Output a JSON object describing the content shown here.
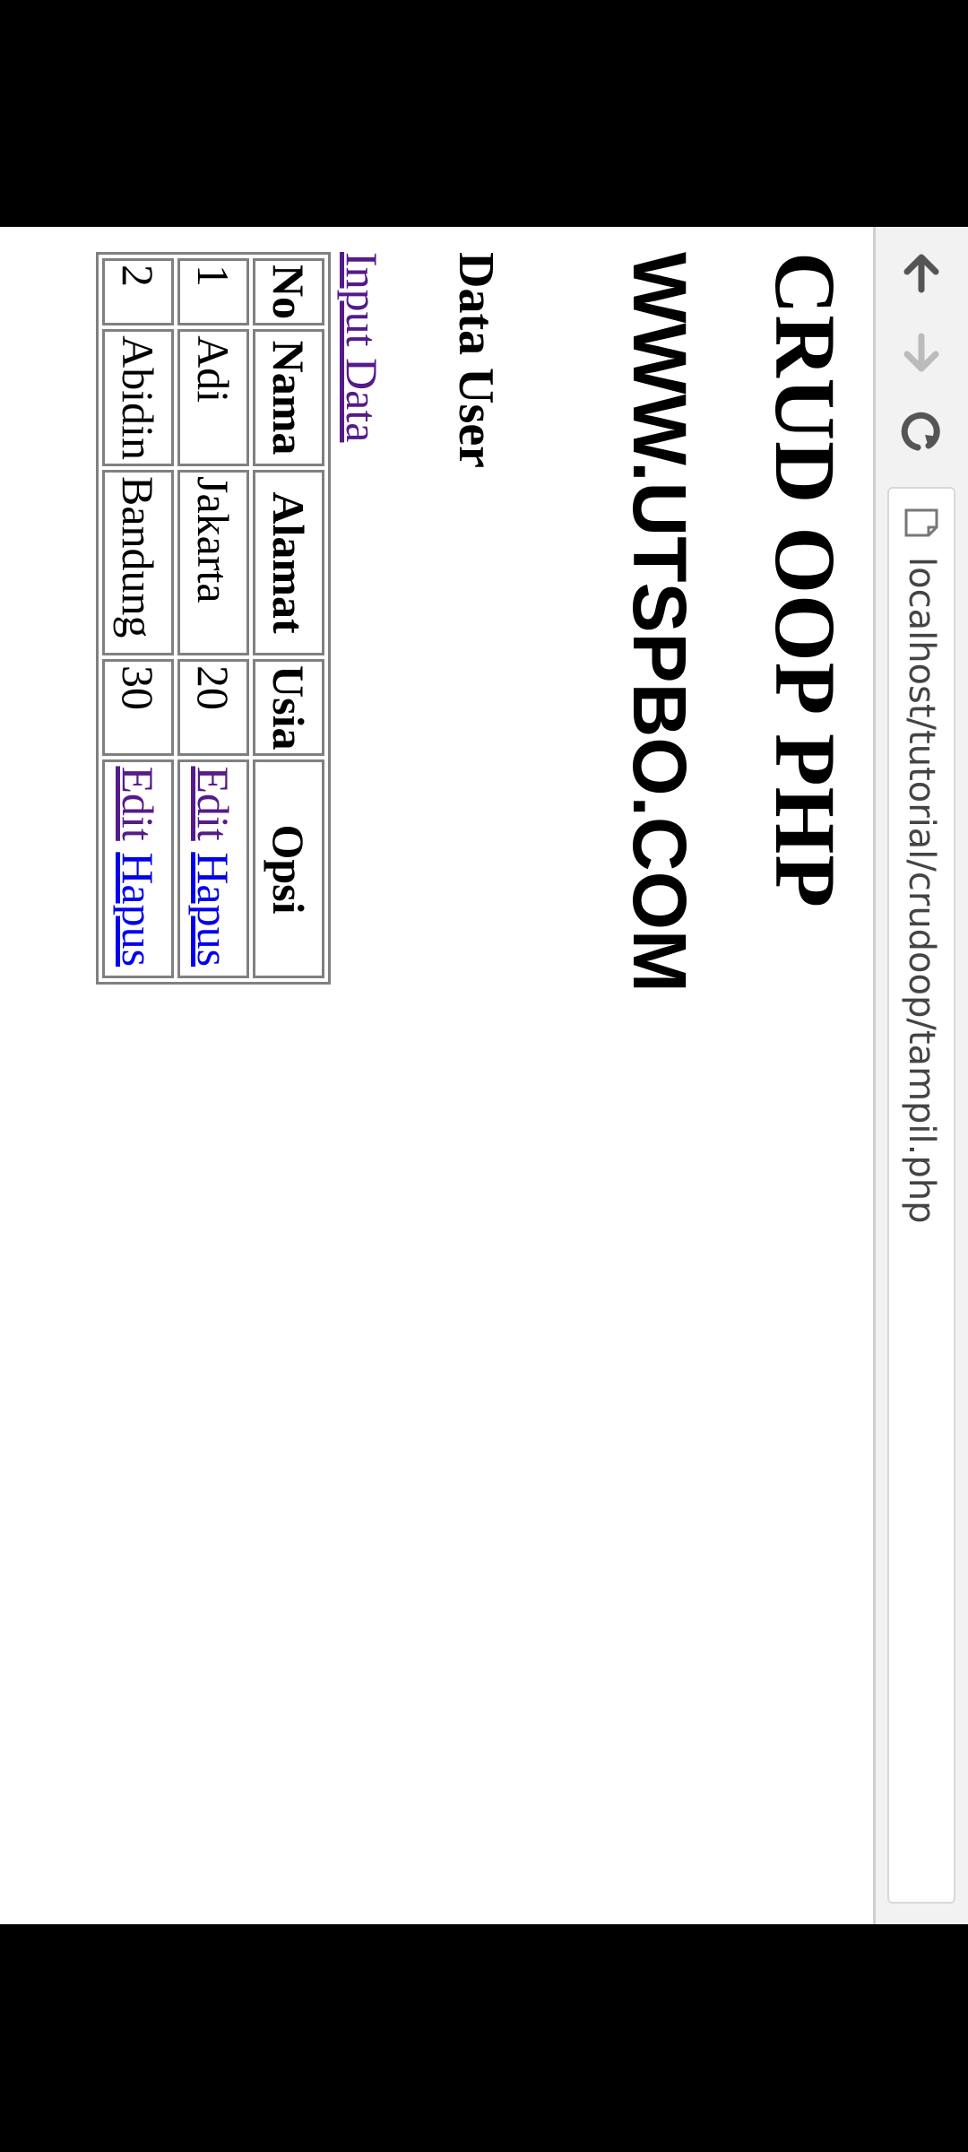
{
  "browser": {
    "url": "localhost/tutorial/crudoop/tampil.php"
  },
  "page": {
    "title": "CRUD OOP PHP",
    "site": "WWW.UTSPBO.COM",
    "section": "Data User",
    "input_link": "Input Data"
  },
  "table": {
    "headers": [
      "No",
      "Nama",
      "Alamat",
      "Usia",
      "Opsi"
    ],
    "rows": [
      {
        "no": "1",
        "nama": "Adi",
        "alamat": "Jakarta",
        "usia": "20",
        "edit": "Edit",
        "hapus": "Hapus"
      },
      {
        "no": "2",
        "nama": "Abidin",
        "alamat": "Bandung",
        "usia": "30",
        "edit": "Edit",
        "hapus": "Hapus"
      }
    ]
  },
  "colors": {
    "visited_link": "#551a8b",
    "link": "#0000ee",
    "toolbar_bg": "#f2f2f2"
  },
  "icons": {
    "back": "arrow-up-icon",
    "forward": "arrow-down-icon",
    "reload": "reload-icon",
    "page": "page-icon"
  }
}
